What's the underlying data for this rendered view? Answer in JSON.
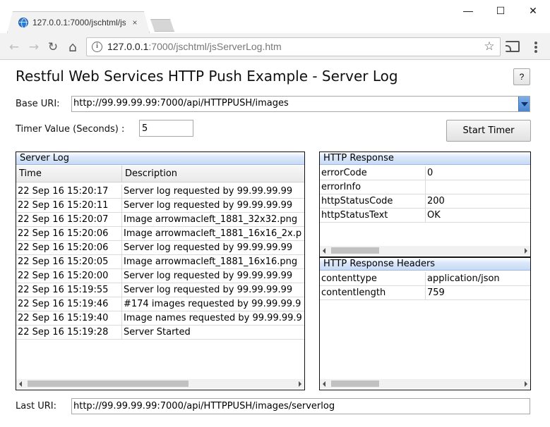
{
  "browser": {
    "tab_title": "127.0.0.1:7000/jschtml/js",
    "tab_close": "×",
    "minimize": "—",
    "maximize": "☐",
    "close": "✕",
    "url_host": "127.0.0.1",
    "url_path": ":7000/jschtml/jsServerLog.htm",
    "back": "←",
    "forward": "→",
    "reload": "↻",
    "home": "⌂",
    "star": "☆"
  },
  "page": {
    "title": "Restful Web Services HTTP Push Example - Server Log",
    "help_label": "?",
    "base_uri_label": "Base URI:",
    "base_uri_value": "http://99.99.99.99:7000/api/HTTPPUSH/images",
    "timer_label": "Timer Value (Seconds) :",
    "timer_value": "5",
    "start_timer_label": "Start Timer",
    "last_uri_label": "Last URI:",
    "last_uri_value": "http://99.99.99.99:7000/api/HTTPPUSH/images/serverlog"
  },
  "server_log": {
    "title": "Server Log",
    "columns": [
      "Time",
      "Description"
    ],
    "rows": [
      [
        "22 Sep 16 15:20:17",
        "Server log requested by 99.99.99.99"
      ],
      [
        "22 Sep 16 15:20:11",
        "Server log requested by 99.99.99.99"
      ],
      [
        "22 Sep 16 15:20:07",
        "Image arrowmacleft_1881_32x32.png"
      ],
      [
        "22 Sep 16 15:20:06",
        "Image arrowmacleft_1881_16x16_2x.p"
      ],
      [
        "22 Sep 16 15:20:06",
        "Server log requested by 99.99.99.99"
      ],
      [
        "22 Sep 16 15:20:05",
        "Image arrowmacleft_1881_16x16.png"
      ],
      [
        "22 Sep 16 15:20:00",
        "Server log requested by 99.99.99.99"
      ],
      [
        "22 Sep 16 15:19:55",
        "Server log requested by 99.99.99.99"
      ],
      [
        "22 Sep 16 15:19:46",
        "#174 images requested by 99.99.99.9"
      ],
      [
        "22 Sep 16 15:19:40",
        "Image names requested by 99.99.99.9"
      ],
      [
        "22 Sep 16 15:19:28",
        "Server Started"
      ]
    ]
  },
  "http_response": {
    "title": "HTTP Response",
    "rows": [
      [
        "errorCode",
        "0"
      ],
      [
        "errorInfo",
        ""
      ],
      [
        "httpStatusCode",
        "200"
      ],
      [
        "httpStatusText",
        "OK"
      ]
    ]
  },
  "http_response_headers": {
    "title": "HTTP Response Headers",
    "rows": [
      [
        "contenttype",
        "application/json"
      ],
      [
        "contentlength",
        "759"
      ]
    ]
  }
}
